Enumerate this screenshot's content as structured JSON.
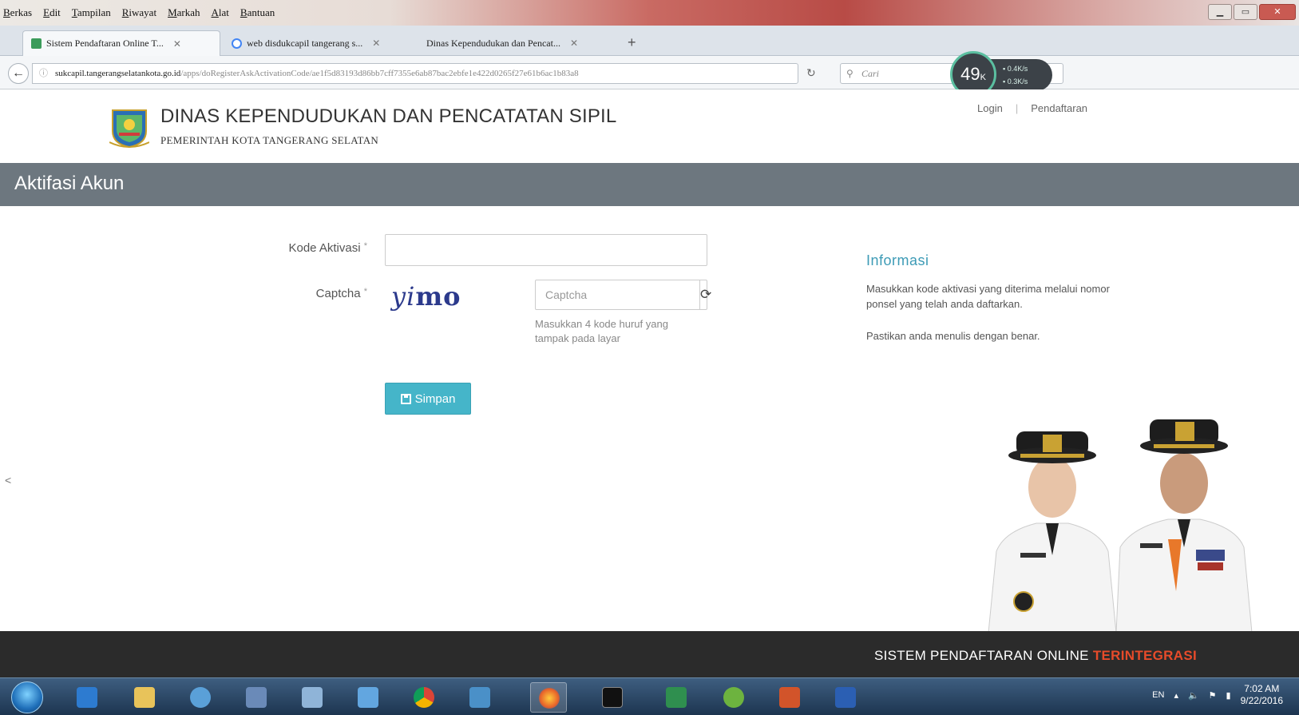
{
  "browser": {
    "menu": [
      "Berkas",
      "Edit",
      "Tampilan",
      "Riwayat",
      "Markah",
      "Alat",
      "Bantuan"
    ],
    "tabs": [
      {
        "label": "Sistem Pendaftaran Online T...",
        "color": "#3b9b5a"
      },
      {
        "label": "web disdukcapil tangerang s...",
        "color": "#4285f4"
      },
      {
        "label": "Dinas Kependudukan dan Pencat...",
        "color": "#dddddd"
      }
    ],
    "url_domain": "sukcapil.tangerangselatankota.go.id",
    "url_path": "/apps/doRegisterAskActivationCode/ae1f5d83193d86bb7cff7355e6ab87bac2ebfe1e422d0265f27e61b6ac1b83a8",
    "search_placeholder": "Cari",
    "speed": {
      "value": "49",
      "unit": "K",
      "up": "0.4",
      "down": "0.3",
      "up_unit": "K/s",
      "down_unit": "K/s"
    }
  },
  "header": {
    "org_name": "DINAS KEPENDUDUKAN DAN PENCATATAN SIPIL",
    "org_sub": "PEMERINTAH KOTA TANGERANG SELATAN",
    "nav_login": "Login",
    "nav_register": "Pendaftaran"
  },
  "page_title": "Aktifasi Akun",
  "form": {
    "kode_label": "Kode Aktivasi",
    "required_mark": "*",
    "kode_value": "",
    "captcha_label": "Captcha",
    "captcha_text_a": "yi",
    "captcha_text_b": "mo",
    "captcha_placeholder": "Captcha",
    "captcha_help": "Masukkan 4 kode huruf yang tampak pada layar",
    "save_label": "Simpan"
  },
  "info": {
    "title": "Informasi",
    "p1": "Masukkan kode aktivasi yang diterima melalui nomor ponsel yang telah anda daftarkan.",
    "p2": "Pastikan anda menulis dengan benar."
  },
  "footer": {
    "tag_a": "SISTEM PENDAFTARAN ONLINE",
    "tag_b": "TERINTEGRASI"
  },
  "taskbar": {
    "lang": "EN",
    "time": "7:02 AM",
    "date": "9/22/2016"
  }
}
